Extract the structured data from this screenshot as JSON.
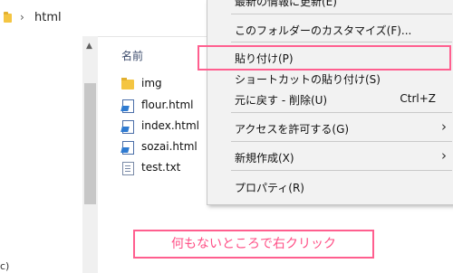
{
  "address": {
    "path": "html",
    "chevron": "›",
    "folder_icon": "folder-icon"
  },
  "nav": {
    "bottom_text": "c)"
  },
  "filelist": {
    "header": "名前",
    "items": [
      {
        "label": "img",
        "icon": "folder-icon"
      },
      {
        "label": "flour.html",
        "icon": "html-file-icon"
      },
      {
        "label": "index.html",
        "icon": "html-file-icon"
      },
      {
        "label": "sozai.html",
        "icon": "html-file-icon"
      },
      {
        "label": "test.txt",
        "icon": "text-file-icon"
      }
    ]
  },
  "context_menu": {
    "items": [
      {
        "label": "最新の情報に更新(E)",
        "shortcut": "",
        "arrow": ""
      },
      {
        "label": "このフォルダーのカスタマイズ(F)...",
        "shortcut": "",
        "arrow": ""
      },
      {
        "label": "貼り付け(P)",
        "shortcut": "",
        "arrow": ""
      },
      {
        "label": "ショートカットの貼り付け(S)",
        "shortcut": "",
        "arrow": ""
      },
      {
        "label": "元に戻す - 削除(U)",
        "shortcut": "Ctrl+Z",
        "arrow": ""
      },
      {
        "label": "アクセスを許可する(G)",
        "shortcut": "",
        "arrow": "›"
      },
      {
        "label": "新規作成(X)",
        "shortcut": "",
        "arrow": "›"
      },
      {
        "label": "プロパティ(R)",
        "shortcut": "",
        "arrow": ""
      }
    ]
  },
  "annotation": {
    "text": "何もないところで右クリック",
    "color": "#ff5f8f"
  }
}
